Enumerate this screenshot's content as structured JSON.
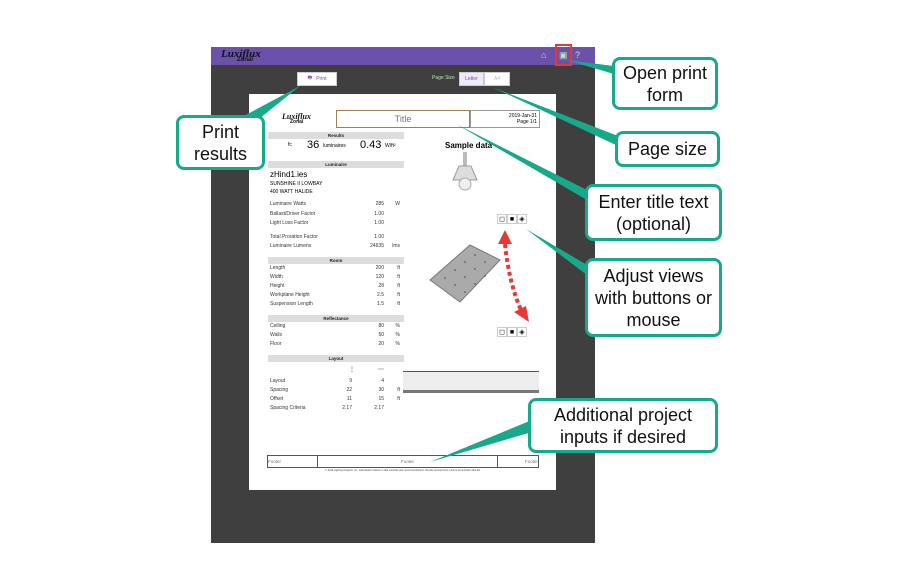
{
  "app": {
    "logo": "Luxiflux",
    "logo_sub": "Zonal",
    "icons": [
      "home-icon",
      "print-icon",
      "help-icon"
    ]
  },
  "toolbar": {
    "print_label": "Print",
    "page_size_label": "Page Size",
    "page_sizes": [
      "Letter",
      "A4"
    ],
    "selected_page_size": "Letter"
  },
  "report": {
    "title_placeholder": "Title",
    "date": "2019-Jan-31",
    "page": "Page 1/1",
    "results": {
      "header": "Results",
      "fc_unit": "fc",
      "luminaires": "36",
      "luminaires_unit": "luminaires",
      "power_density": "0.43",
      "power_unit": "W/ft²"
    },
    "luminaire": {
      "header": "Luminaire",
      "file": "zHind1.ies",
      "name": "SUNSHINE II LOWBAY",
      "lamp": "400 WATT HALIDE",
      "rows": [
        {
          "label": "Luminaire Watts",
          "value": "285",
          "unit": "W"
        },
        {
          "label": "Ballast/Driver Factor",
          "value": "1.00",
          "unit": ""
        },
        {
          "label": "Light Loss Factor",
          "value": "1.00",
          "unit": ""
        },
        {
          "label": "Total Proration Factor",
          "value": "1.00",
          "unit": ""
        },
        {
          "label": "Luminaire Lumens",
          "value": "24635",
          "unit": "lms"
        }
      ]
    },
    "room": {
      "header": "Room",
      "rows": [
        {
          "label": "Length",
          "value": "200",
          "unit": "ft"
        },
        {
          "label": "Width",
          "value": "120",
          "unit": "ft"
        },
        {
          "label": "Height",
          "value": "28",
          "unit": "ft"
        },
        {
          "label": "Workplane Height",
          "value": "2.5",
          "unit": "ft"
        },
        {
          "label": "Suspension Length",
          "value": "1.5",
          "unit": "ft"
        }
      ]
    },
    "reflectance": {
      "header": "Reflectance",
      "rows": [
        {
          "label": "Ceiling",
          "value": "80",
          "unit": "%"
        },
        {
          "label": "Walls",
          "value": "50",
          "unit": "%"
        },
        {
          "label": "Floor",
          "value": "20",
          "unit": "%"
        }
      ]
    },
    "layout": {
      "header": "Layout",
      "rows": [
        {
          "label": "Layout",
          "a": "9",
          "b": "4",
          "unit": ""
        },
        {
          "label": "Spacing",
          "a": "22",
          "b": "30",
          "unit": "ft"
        },
        {
          "label": "Offset",
          "a": "11",
          "b": "15",
          "unit": "ft"
        },
        {
          "label": "Spacing Criteria",
          "a": "2.17",
          "b": "2.17",
          "unit": ""
        }
      ]
    },
    "sample_label": "Sample data",
    "footers": [
      "Footer",
      "Footer",
      "Footer"
    ],
    "copyright": "© 2019 Lighting Analysts, Inc. Calculations based on IES methods and recommendations. Results derived from content of luminaire data file."
  },
  "callouts": {
    "print": "Print results",
    "open_print": "Open print form",
    "page_size": "Page size",
    "title": "Enter title text (optional)",
    "views": "Adjust views with buttons or mouse",
    "inputs": "Additional project inputs if desired"
  },
  "colors": {
    "header": "#6c51ab",
    "frame": "#3f3f3f",
    "callout_border": "#17a98a",
    "highlight": "#e53935"
  }
}
